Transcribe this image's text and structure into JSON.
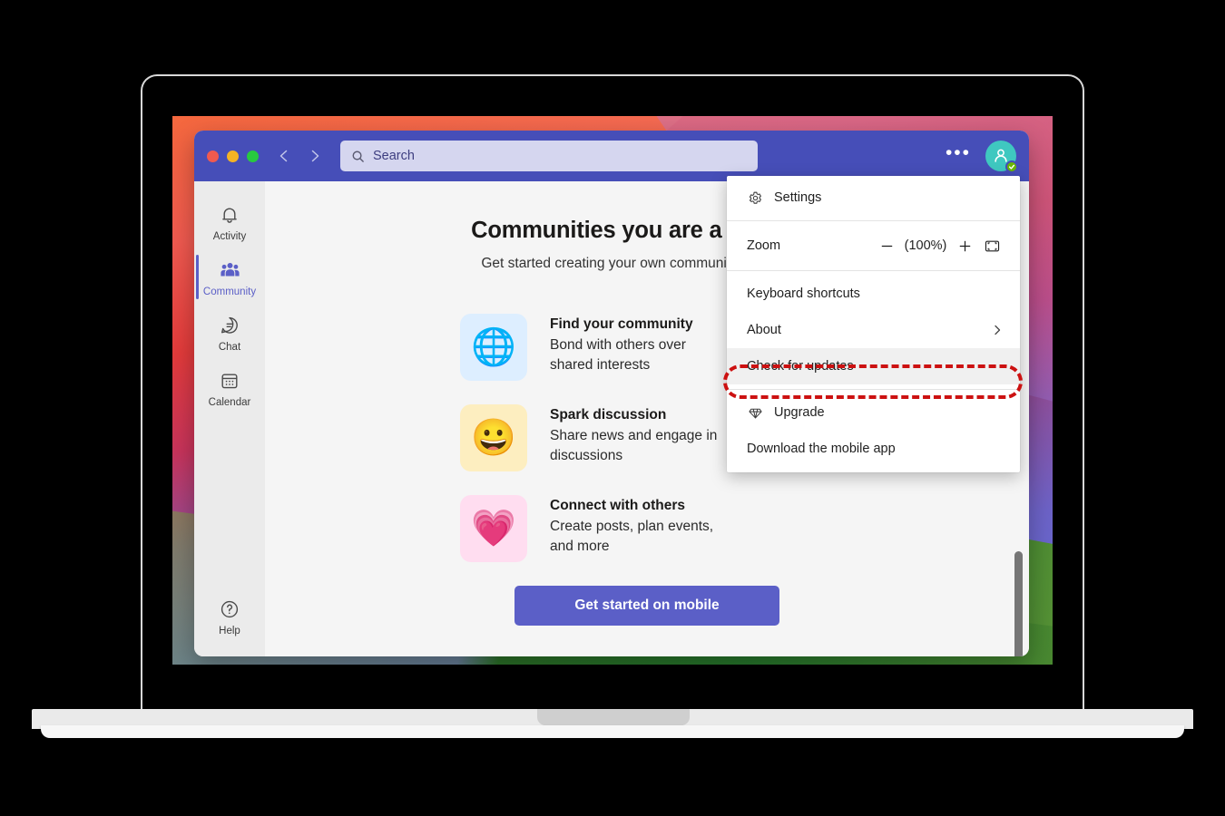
{
  "window": {
    "traffic_lights": [
      "close",
      "minimize",
      "maximize"
    ],
    "back_label": "Back",
    "forward_label": "Forward",
    "more_options_label": "More options",
    "avatar_label": "Account manager",
    "presence": "Available"
  },
  "search": {
    "placeholder": "Search",
    "value": "Search"
  },
  "rail": {
    "items": [
      {
        "id": "activity",
        "label": "Activity",
        "icon": "bell-icon",
        "active": false
      },
      {
        "id": "community",
        "label": "Community",
        "icon": "people-icon",
        "active": true
      },
      {
        "id": "chat",
        "label": "Chat",
        "icon": "chat-icon",
        "active": false
      },
      {
        "id": "calendar",
        "label": "Calendar",
        "icon": "calendar-icon",
        "active": false
      }
    ],
    "help": {
      "id": "help",
      "label": "Help",
      "icon": "question-circle-icon"
    }
  },
  "main": {
    "headline": "Communities you are a part of w",
    "subhead": "Get started creating your own community by downloa",
    "features": [
      {
        "icon": "globe-emoji",
        "tile_color": "#ddeeff",
        "title": "Find your community",
        "desc": "Bond with others over shared interests"
      },
      {
        "icon": "grinning-face-emoji",
        "tile_color": "#fdeec0",
        "title": "Spark discussion",
        "desc": "Share news and engage in discussions"
      },
      {
        "icon": "growing-heart-emoji",
        "tile_color": "#ffddf0",
        "title": "Connect with others",
        "desc": "Create posts, plan events, and more"
      }
    ],
    "cta_label": "Get started on mobile",
    "scrollbar_label": "Vertical scrollbar"
  },
  "menu": {
    "settings_label": "Settings",
    "settings_icon": "gear-icon",
    "zoom": {
      "label": "Zoom",
      "decrease_icon": "minus-icon",
      "value": "(100%)",
      "increase_icon": "plus-icon",
      "reset_icon": "fit-to-screen-icon"
    },
    "keyboard_shortcuts_label": "Keyboard shortcuts",
    "about_label": "About",
    "about_submenu_icon": "chevron-right-icon",
    "check_for_updates_label": "Check for updates",
    "upgrade_label": "Upgrade",
    "upgrade_icon": "diamond-icon",
    "download_mobile_label": "Download the mobile app"
  },
  "colors": {
    "brand_purple": "#5b5fc7",
    "titlebar": "#464eb8",
    "highlight_red": "#cc1111",
    "presence_green": "#6bb700",
    "avatar_teal": "#3fc8c0"
  }
}
